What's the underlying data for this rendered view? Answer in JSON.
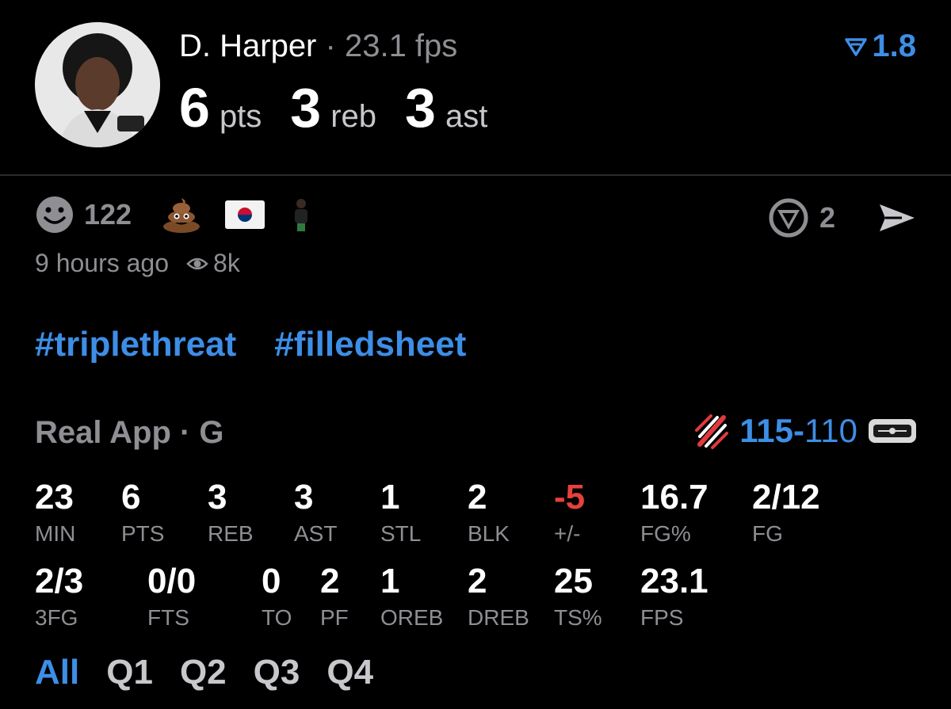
{
  "header": {
    "player_name": "D. Harper",
    "separator": "·",
    "fps": "23.1 fps",
    "rating": "1.8",
    "statline": [
      {
        "num": "6",
        "unit": "pts"
      },
      {
        "num": "3",
        "unit": "reb"
      },
      {
        "num": "3",
        "unit": "ast"
      }
    ]
  },
  "reactions": {
    "smiley_count": "122",
    "share_count": "2"
  },
  "meta": {
    "time_ago": "9 hours ago",
    "views": "8k"
  },
  "hashtags": [
    "#triplethreat",
    "#filledsheet"
  ],
  "game": {
    "title": "Real App · G",
    "score_home": "115",
    "score_dash": "-",
    "score_away": "110"
  },
  "stats_row1": [
    {
      "value": "23",
      "label": "MIN"
    },
    {
      "value": "6",
      "label": "PTS"
    },
    {
      "value": "3",
      "label": "REB"
    },
    {
      "value": "3",
      "label": "AST"
    },
    {
      "value": "1",
      "label": "STL"
    },
    {
      "value": "2",
      "label": "BLK"
    },
    {
      "value": "-5",
      "label": "+/-"
    },
    {
      "value": "16.7",
      "label": "FG%"
    },
    {
      "value": "2/12",
      "label": "FG"
    }
  ],
  "stats_row2": [
    {
      "value": "2/3",
      "label": "3FG"
    },
    {
      "value": "0/0",
      "label": "FTS"
    },
    {
      "value": "0",
      "label": "TO"
    },
    {
      "value": "2",
      "label": "PF"
    },
    {
      "value": "1",
      "label": "OREB"
    },
    {
      "value": "2",
      "label": "DREB"
    },
    {
      "value": "25",
      "label": "TS%"
    },
    {
      "value": "23.1",
      "label": "FPS"
    }
  ],
  "quarter_tabs": [
    "All",
    "Q1",
    "Q2",
    "Q3",
    "Q4"
  ],
  "colors": {
    "accent": "#3d8ee6",
    "negative": "#e5413d",
    "muted": "#8e8e93"
  }
}
